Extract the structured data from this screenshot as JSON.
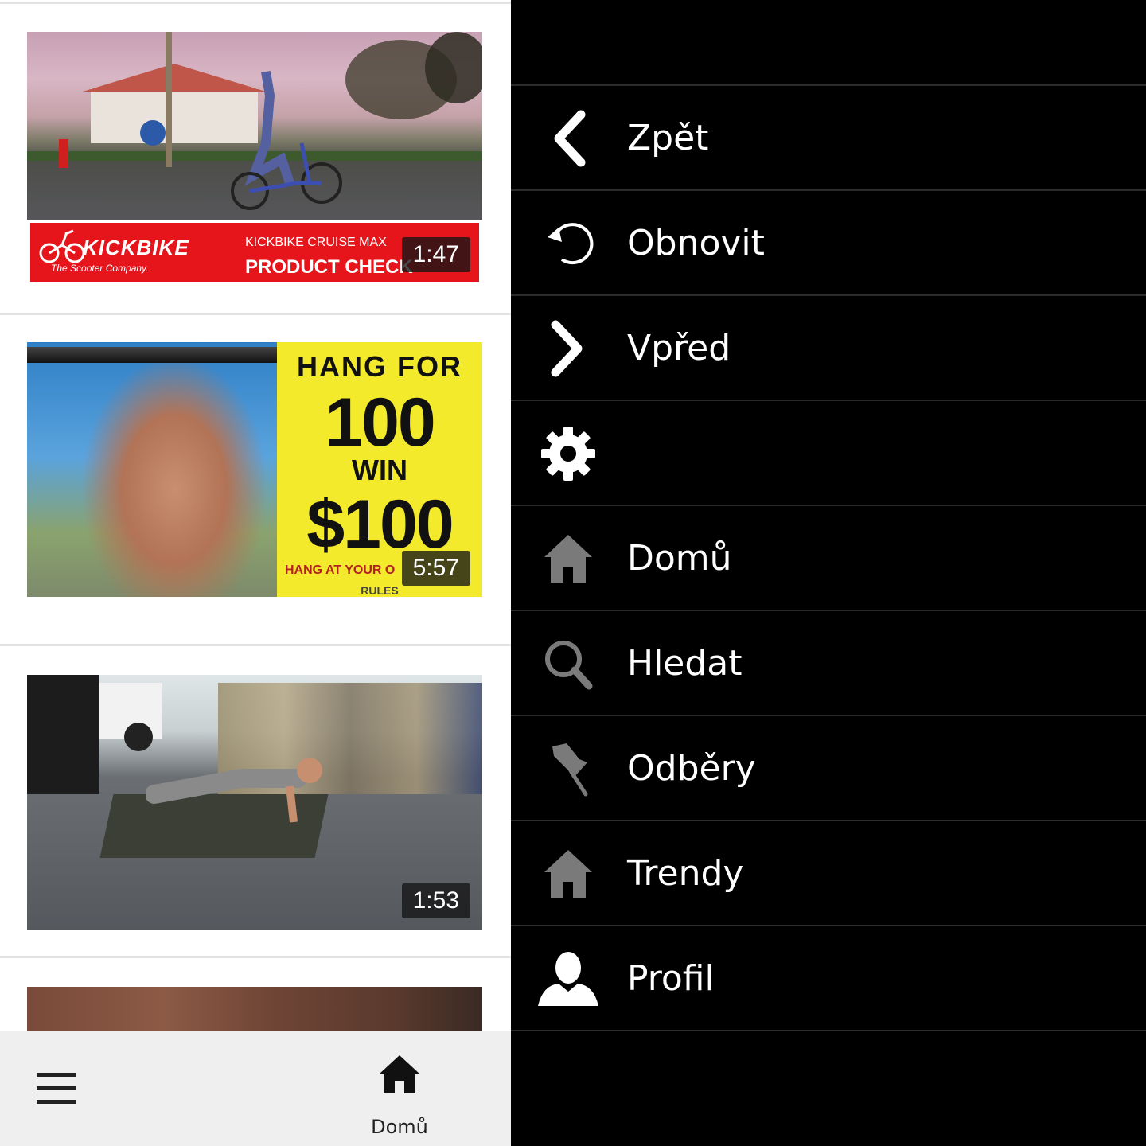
{
  "colors": {
    "drawer_background": "#000000",
    "drawer_divider": "#2b2b2b",
    "feed_background": "#ffffff",
    "bottom_bar_background": "#efefef",
    "banner_red": "#e6151c",
    "sign_yellow": "#f4ea2c"
  },
  "feed": {
    "videos": [
      {
        "duration": "1:47",
        "banner": {
          "logo": "KICKBIKE",
          "tagline": "The Scooter Company.",
          "subtitle": "KICKBIKE CRUISE MAX",
          "title": "PRODUCT CHECK"
        }
      },
      {
        "duration": "5:57",
        "sign": {
          "line1": "HANG FOR",
          "line2": "100",
          "line3": "WIN",
          "line4": "$100",
          "line5": "HANG AT YOUR O",
          "line6": "RULES"
        }
      },
      {
        "duration": "1:53"
      },
      {}
    ]
  },
  "bottom_bar": {
    "menu_icon": "hamburger-icon",
    "home_icon": "home-icon",
    "home_label": "Domů"
  },
  "drawer": {
    "items": [
      {
        "icon": "chevron-left-icon",
        "label": "Zpět"
      },
      {
        "icon": "refresh-icon",
        "label": "Obnovit"
      },
      {
        "icon": "chevron-right-icon",
        "label": "Vpřed"
      },
      {
        "icon": "gear-icon",
        "label": ""
      },
      {
        "icon": "home-icon",
        "label": "Domů"
      },
      {
        "icon": "search-icon",
        "label": "Hledat"
      },
      {
        "icon": "pin-icon",
        "label": "Odběry"
      },
      {
        "icon": "home-icon",
        "label": "Trendy"
      },
      {
        "icon": "user-icon",
        "label": "Profil"
      }
    ]
  }
}
